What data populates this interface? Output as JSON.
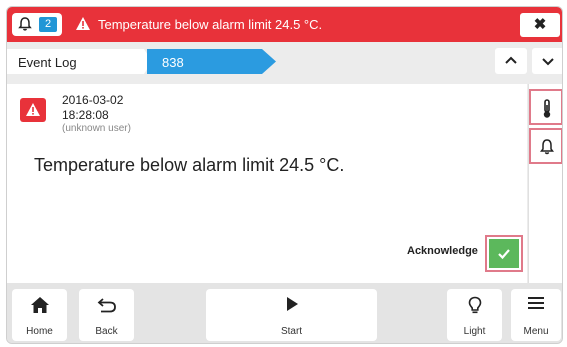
{
  "alarm": {
    "count": "2",
    "message": "Temperature below alarm limit 24.5 °C.",
    "close_symbol": "✖"
  },
  "breadcrumb": {
    "items": [
      "Event Log",
      "838"
    ]
  },
  "event": {
    "date": "2016-03-02",
    "time": "18:28:08",
    "user": "(unknown user)",
    "message": "Temperature below alarm limit 24.5 °C.",
    "acknowledge_label": "Acknowledge"
  },
  "side_buttons": [
    "thermometer-icon",
    "bell-icon"
  ],
  "bottom_nav": {
    "home": "Home",
    "back": "Back",
    "start": "Start",
    "light": "Light",
    "menu": "Menu"
  },
  "colors": {
    "alarm_red": "#e8323a",
    "accent_blue": "#2b9be0",
    "ack_green": "#5cb85c",
    "highlight_pink": "#e07a8a"
  }
}
